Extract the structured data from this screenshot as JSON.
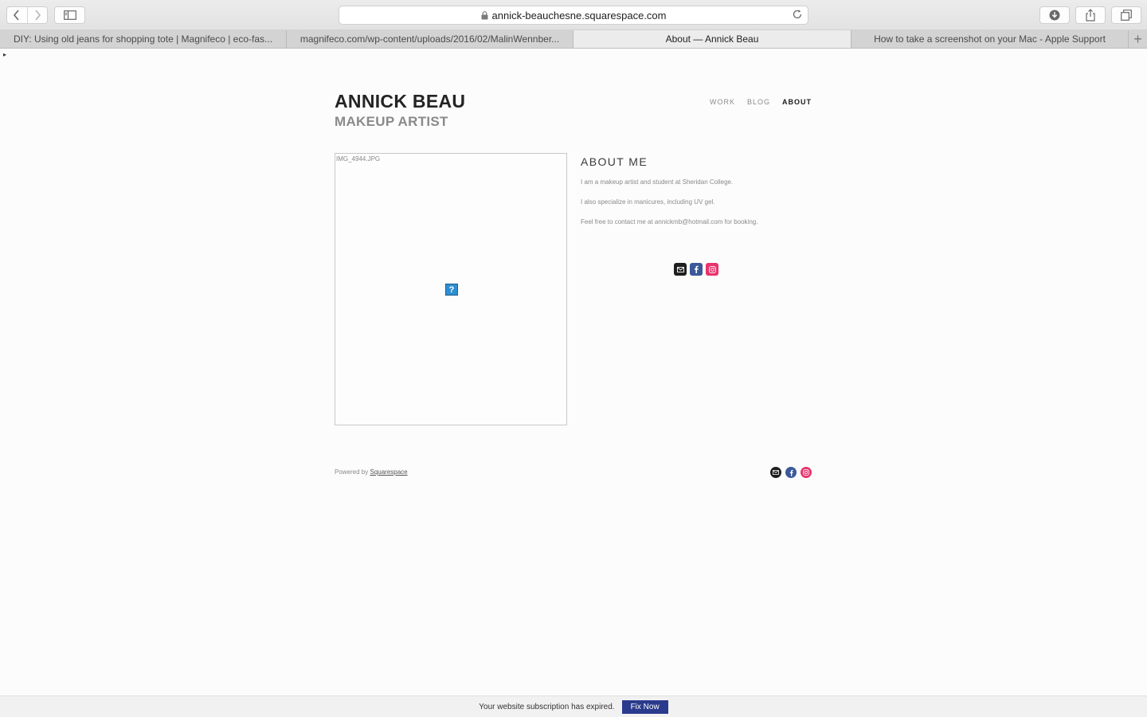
{
  "browser": {
    "url": "annick-beauchesne.squarespace.com",
    "tabs": [
      {
        "label": "DIY: Using old jeans for shopping tote | Magnifeco | eco-fas...",
        "active": false
      },
      {
        "label": "magnifeco.com/wp-content/uploads/2016/02/MalinWennber...",
        "active": false
      },
      {
        "label": "About — Annick Beau",
        "active": true
      },
      {
        "label": "How to take a screenshot on your Mac - Apple Support",
        "active": false
      }
    ],
    "new_tab_symbol": "+"
  },
  "site": {
    "title": "ANNICK BEAU",
    "tagline": "MAKEUP ARTIST",
    "nav": [
      {
        "label": "WORK",
        "active": false
      },
      {
        "label": "BLOG",
        "active": false
      },
      {
        "label": "ABOUT",
        "active": true
      }
    ]
  },
  "image": {
    "alt_text": "IMG_4944.JPG",
    "broken_symbol": "?"
  },
  "about": {
    "heading": "ABOUT ME",
    "paragraphs": [
      "I am a makeup artist and student at Sheridan College.",
      "I also specialize in manicures, including  UV gel.",
      "Feel free to contact me at annickmb@hotmail.com for booking."
    ]
  },
  "social": {
    "icons": [
      "mail-icon",
      "facebook-icon",
      "instagram-icon"
    ],
    "colors": {
      "mail": "#1f1f1f",
      "facebook": "#3b5998",
      "instagram": "#e8336d"
    }
  },
  "footer": {
    "powered_prefix": "Powered by",
    "powered_link": "Squarespace"
  },
  "banner": {
    "message": "Your website subscription has expired.",
    "button": "Fix Now",
    "button_color": "#2a3a8c"
  }
}
